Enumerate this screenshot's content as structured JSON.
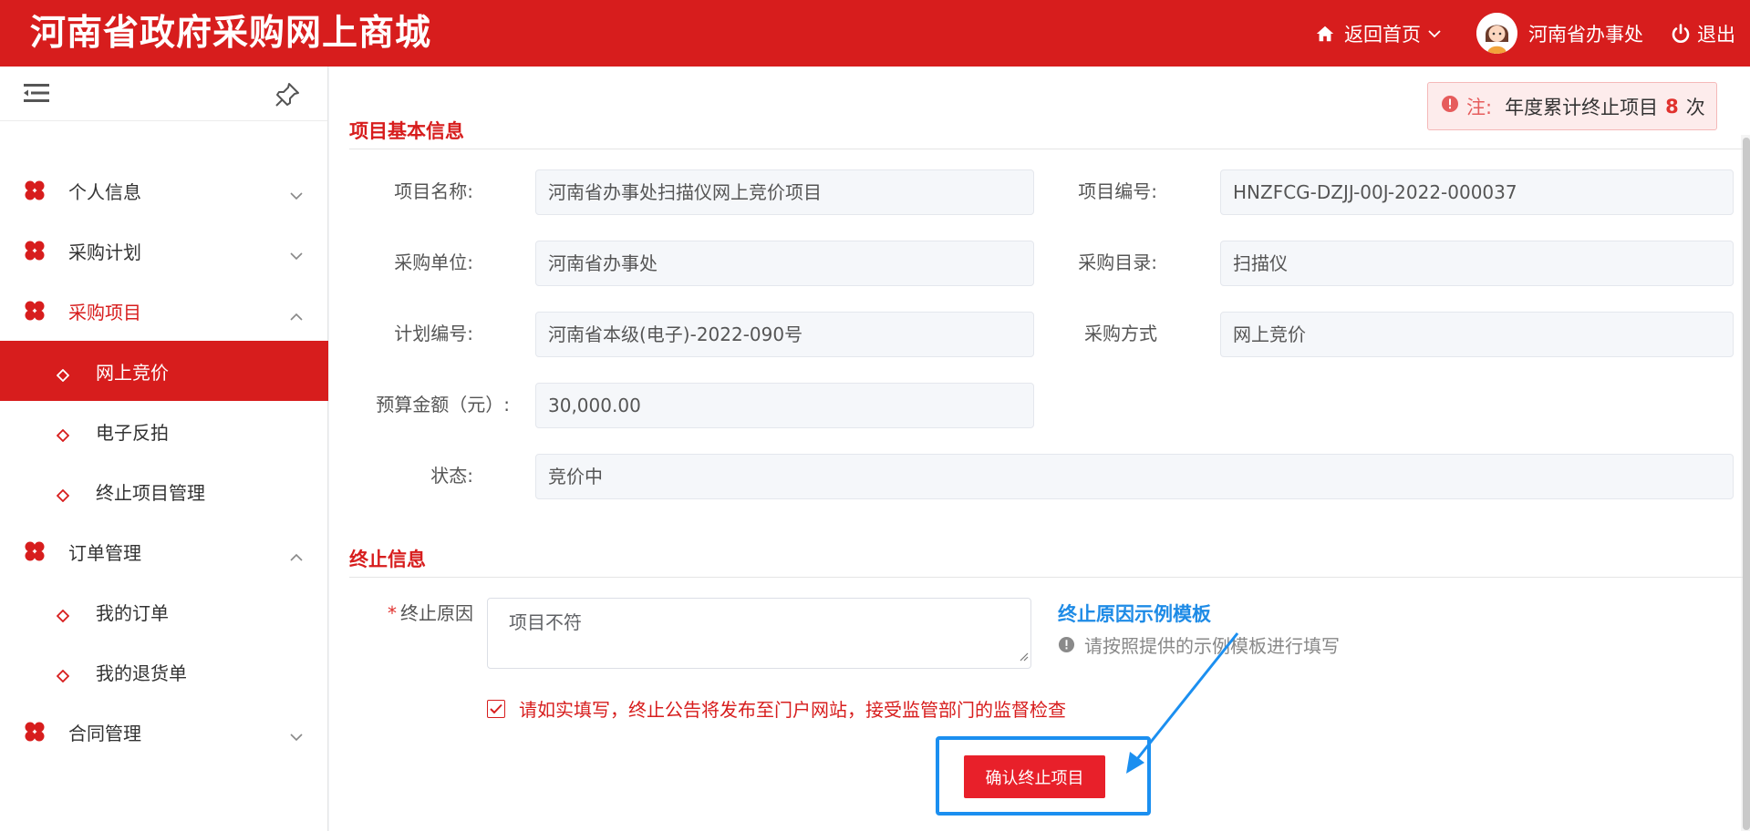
{
  "header": {
    "brand": "河南省政府采购网上商城",
    "home_label": "返回首页",
    "user_name": "河南省办事处",
    "logout_label": "退出"
  },
  "sidebar": {
    "menu": [
      {
        "label": "个人信息",
        "expanded": false
      },
      {
        "label": "采购计划",
        "expanded": false
      },
      {
        "label": "采购项目",
        "expanded": true
      },
      {
        "label": "订单管理",
        "expanded": true
      },
      {
        "label": "合同管理",
        "expanded": false
      }
    ],
    "sub_procurement": [
      {
        "label": "网上竞价",
        "active": true
      },
      {
        "label": "电子反拍",
        "active": false
      },
      {
        "label": "终止项目管理",
        "active": false
      }
    ],
    "sub_orders": [
      {
        "label": "我的订单"
      },
      {
        "label": "我的退货单"
      }
    ]
  },
  "note": {
    "prefix": "注:",
    "text": "年度累计终止项目",
    "count": "8",
    "suffix": "次"
  },
  "basic_info": {
    "title": "项目基本信息",
    "fields": {
      "project_name": {
        "label": "项目名称:",
        "value": "河南省办事处扫描仪网上竞价项目"
      },
      "project_no": {
        "label": "项目编号:",
        "value": "HNZFCG-DZJJ-00J-2022-000037"
      },
      "purchaser": {
        "label": "采购单位:",
        "value": "河南省办事处"
      },
      "catalog": {
        "label": "采购目录:",
        "value": "扫描仪"
      },
      "plan_no": {
        "label": "计划编号:",
        "value": "河南省本级(电子)-2022-090号"
      },
      "method": {
        "label": "采购方式",
        "value": "网上竞价"
      },
      "budget": {
        "label": "预算金额（元）:",
        "value": "30,000.00"
      },
      "status": {
        "label": "状态:",
        "value": "竞价中"
      }
    }
  },
  "termination": {
    "title": "终止信息",
    "reason_label": "终止原因",
    "reason_value": "项目不符",
    "template_link": "终止原因示例模板",
    "template_hint": "请按照提供的示例模板进行填写",
    "agree_text": "请如实填写，终止公告将发布至门户网站，接受监管部门的监督检查",
    "agree_checked": true,
    "confirm_label": "确认终止项目"
  },
  "colors": {
    "brand_red": "#d71d1d",
    "highlight_blue": "#1b8ff0"
  }
}
